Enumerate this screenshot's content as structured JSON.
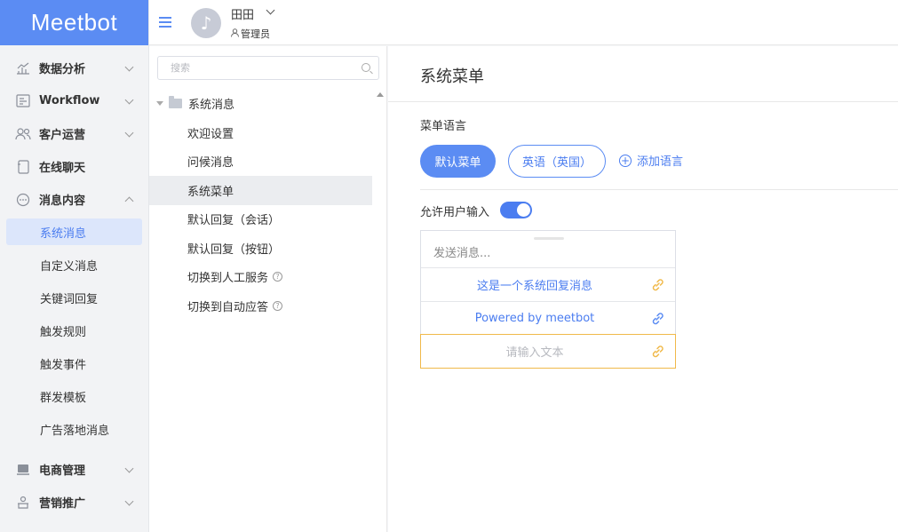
{
  "app": {
    "logo": "Meetbot"
  },
  "header": {
    "user_name": "田田",
    "user_role": "管理员"
  },
  "sidebar": {
    "items": [
      {
        "label": "数据分析",
        "icon": "chart-icon"
      },
      {
        "label": "Workflow",
        "icon": "workflow-icon"
      },
      {
        "label": "客户运营",
        "icon": "users-icon"
      },
      {
        "label": "在线聊天",
        "icon": "chat-icon"
      },
      {
        "label": "消息内容",
        "icon": "message-icon"
      }
    ],
    "sub_items": [
      "系统消息",
      "自定义消息",
      "关键词回复",
      "触发规则",
      "触发事件",
      "群发模板",
      "广告落地消息"
    ],
    "items_after": [
      {
        "label": "电商管理",
        "icon": "shop-icon"
      },
      {
        "label": "营销推广",
        "icon": "marketing-icon"
      }
    ]
  },
  "midpanel": {
    "search_placeholder": "搜索",
    "root": "系统消息",
    "items": [
      "欢迎设置",
      "问候消息",
      "系统菜单",
      "默认回复（会话）",
      "默认回复（按钮）",
      "切换到人工服务",
      "切换到自动应答"
    ],
    "active_index": 2
  },
  "content": {
    "title": "系统菜单",
    "lang_label": "菜单语言",
    "btn_default": "默认菜单",
    "btn_english": "英语（英国）",
    "add_lang": "添加语言",
    "allow_label": "允许用户输入",
    "allow_enabled": true,
    "preview": {
      "send_placeholder": "发送消息...",
      "rows": [
        "这是一个系统回复消息",
        "Powered by meetbot",
        "请输入文本"
      ]
    }
  },
  "colors": {
    "accent": "#5b8cf3",
    "link_orange": "#f0b94a",
    "link_blue": "#5b8cf3"
  }
}
